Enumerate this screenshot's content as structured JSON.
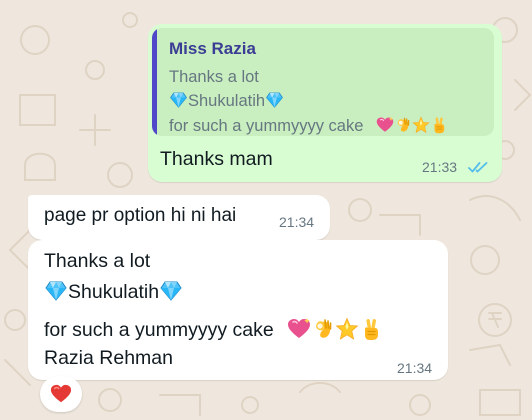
{
  "chat": {
    "reply_message": {
      "quote_author": "Miss Razia",
      "quote_line1": "Thanks a lot",
      "quote_line2_name": "Shukulatih",
      "quote_line3": "for such a yummyyyy cake",
      "text": "Thanks mam",
      "time": "21:33",
      "status": "read",
      "quote_color": "#5147c9"
    },
    "message_1": {
      "text": "page pr option hi ni hai",
      "time": "21:34"
    },
    "message_2": {
      "line1": "Thanks a lot",
      "line2_name": "Shukulatih",
      "line3": "for such a yummyyyy cake",
      "line4": "Razia Rehman",
      "time": "21:34",
      "emojis": [
        "sparkling-heart",
        "ok-hand",
        "star",
        "victory-hand"
      ]
    },
    "reaction": "red-heart"
  },
  "colors": {
    "wallpaper": "#efe7dd",
    "outgoing_bubble": "#d9fdd3",
    "incoming_bubble": "#ffffff",
    "read_ticks": "#53bdeb"
  }
}
